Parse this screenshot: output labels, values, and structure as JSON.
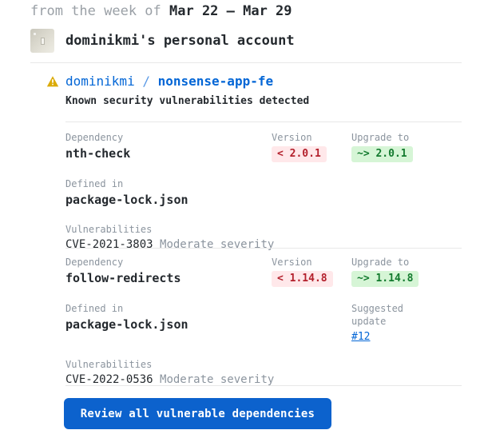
{
  "week": {
    "prefix": "from the week of ",
    "range": "Mar 22 – Mar 29"
  },
  "account": {
    "name": "dominikmi's personal account",
    "avatar_icon": "user-avatar-image"
  },
  "repo": {
    "warning_icon": "warning-triangle-icon",
    "owner": "dominikmi",
    "separator": " / ",
    "name": "nonsense-app-fe",
    "subtitle": "Known security vulnerabilities detected"
  },
  "labels": {
    "dependency": "Dependency",
    "version": "Version",
    "upgrade_to": "Upgrade to",
    "defined_in": "Defined in",
    "vulnerabilities": "Vulnerabilities",
    "suggested_update": "Suggested\nupdate"
  },
  "colors": {
    "link": "#0366d6",
    "warning": "#dbab09",
    "pill_bad_bg": "#ffe8ea",
    "pill_bad_fg": "#b3202c",
    "pill_good_bg": "#d6f5d6",
    "pill_good_fg": "#137a2e",
    "button_bg": "#0c62cd",
    "muted_text": "#8b949e",
    "body_text": "#24292e",
    "divider": "#e8e8e8"
  },
  "dependencies": [
    {
      "name": "nth-check",
      "version": "< 2.0.1",
      "upgrade_to": "~> 2.0.1",
      "defined_in": "package-lock.json",
      "suggested_update": null,
      "cve": "CVE-2021-3803",
      "severity": "Moderate severity"
    },
    {
      "name": "follow-redirects",
      "version": "< 1.14.8",
      "upgrade_to": "~> 1.14.8",
      "defined_in": "package-lock.json",
      "suggested_update": "#12",
      "cve": "CVE-2022-0536",
      "severity": "Moderate severity"
    }
  ],
  "button": {
    "label": "Review all vulnerable dependencies"
  }
}
